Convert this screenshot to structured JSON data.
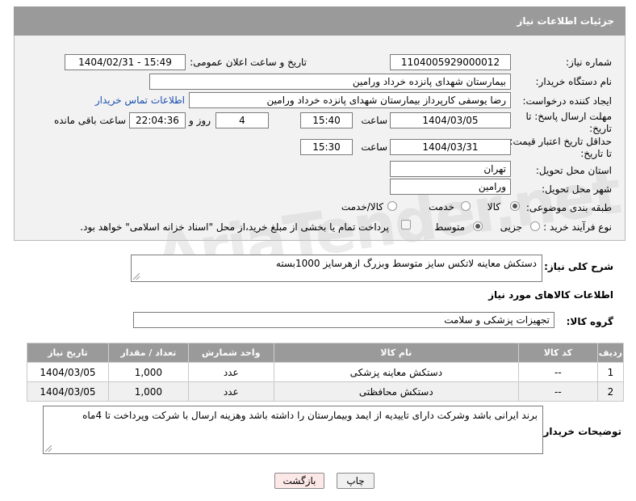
{
  "header": {
    "title": "جزئیات اطلاعات نیاز"
  },
  "fields": {
    "need_number_label": "شماره نیاز:",
    "need_number": "1104005929000012",
    "announce_label": "تاریخ و ساعت اعلان عمومی:",
    "announce_value": "1404/02/31 - 15:49",
    "buyer_org_label": "نام دستگاه خریدار:",
    "buyer_org": "بیمارستان شهدای پانزده خرداد ورامین",
    "requester_label": "ایجاد کننده درخواست:",
    "requester": "رضا یوسفی کارپرداز بیمارستان شهدای پانزده خرداد ورامین",
    "contact_link": "اطلاعات تماس خریدار",
    "deadline_label_1": "مهلت ارسال پاسخ: تا",
    "deadline_label_2": "تاریخ:",
    "deadline_date": "1404/03/05",
    "time_label": "ساعت",
    "deadline_time": "15:40",
    "days_value": "4",
    "days_label": "روز و",
    "remaining_time": "22:04:36",
    "remaining_label": "ساعت باقی مانده",
    "validity_label_1": "حداقل تاریخ اعتبار قیمت:",
    "validity_label_2": "تا تاریخ:",
    "validity_date": "1404/03/31",
    "validity_time": "15:30",
    "province_label": "استان محل تحویل:",
    "province": "تهران",
    "city_label": "شهر محل تحویل:",
    "city": "ورامین",
    "category_label": "طبقه بندی موضوعی:",
    "category_goods": "کالا",
    "category_service": "خدمت",
    "category_both": "کالا/خدمت",
    "process_label": "نوع فرآیند خرید :",
    "process_partial": "جزیی",
    "process_medium": "متوسط",
    "payment_note": "پرداخت تمام یا بخشی از مبلغ خرید،از محل \"اسناد خزانه اسلامی\" خواهد بود."
  },
  "description": {
    "label": "شرح کلی نیاز:",
    "value": "دستکش معاینه لاتکس سایز متوسط وبزرگ ازهرسایز 1000بسته"
  },
  "goods_info_title": "اطلاعات کالاهای مورد نیاز",
  "goods_group": {
    "label": "گروه کالا:",
    "value": "تجهیزات پزشکی و سلامت"
  },
  "table": {
    "headers": [
      "ردیف",
      "کد کالا",
      "نام کالا",
      "واحد شمارش",
      "تعداد / مقدار",
      "تاریخ نیاز"
    ],
    "rows": [
      [
        "1",
        "--",
        "دستکش معاینه پزشکی",
        "عدد",
        "1,000",
        "1404/03/05"
      ],
      [
        "2",
        "--",
        "دستکش محافظتی",
        "عدد",
        "1,000",
        "1404/03/05"
      ]
    ]
  },
  "buyer_notes": {
    "label": "توضیحات خریدار:",
    "value": "برند ایرانی باشد وشرکت دارای تاییدیه از ایمد وبیمارستان را داشته باشد وهزینه ارسال با شرکت وپرداخت تا 4ماه"
  },
  "buttons": {
    "print": "چاپ",
    "back": "بازگشت"
  },
  "watermark": "AriaTender.net",
  "colors": {
    "header_bg": "#9a9a9a",
    "link": "#1a4fb0",
    "back_btn_bg": "#fde8e8",
    "print_btn_bg": "#f0f0f0"
  }
}
